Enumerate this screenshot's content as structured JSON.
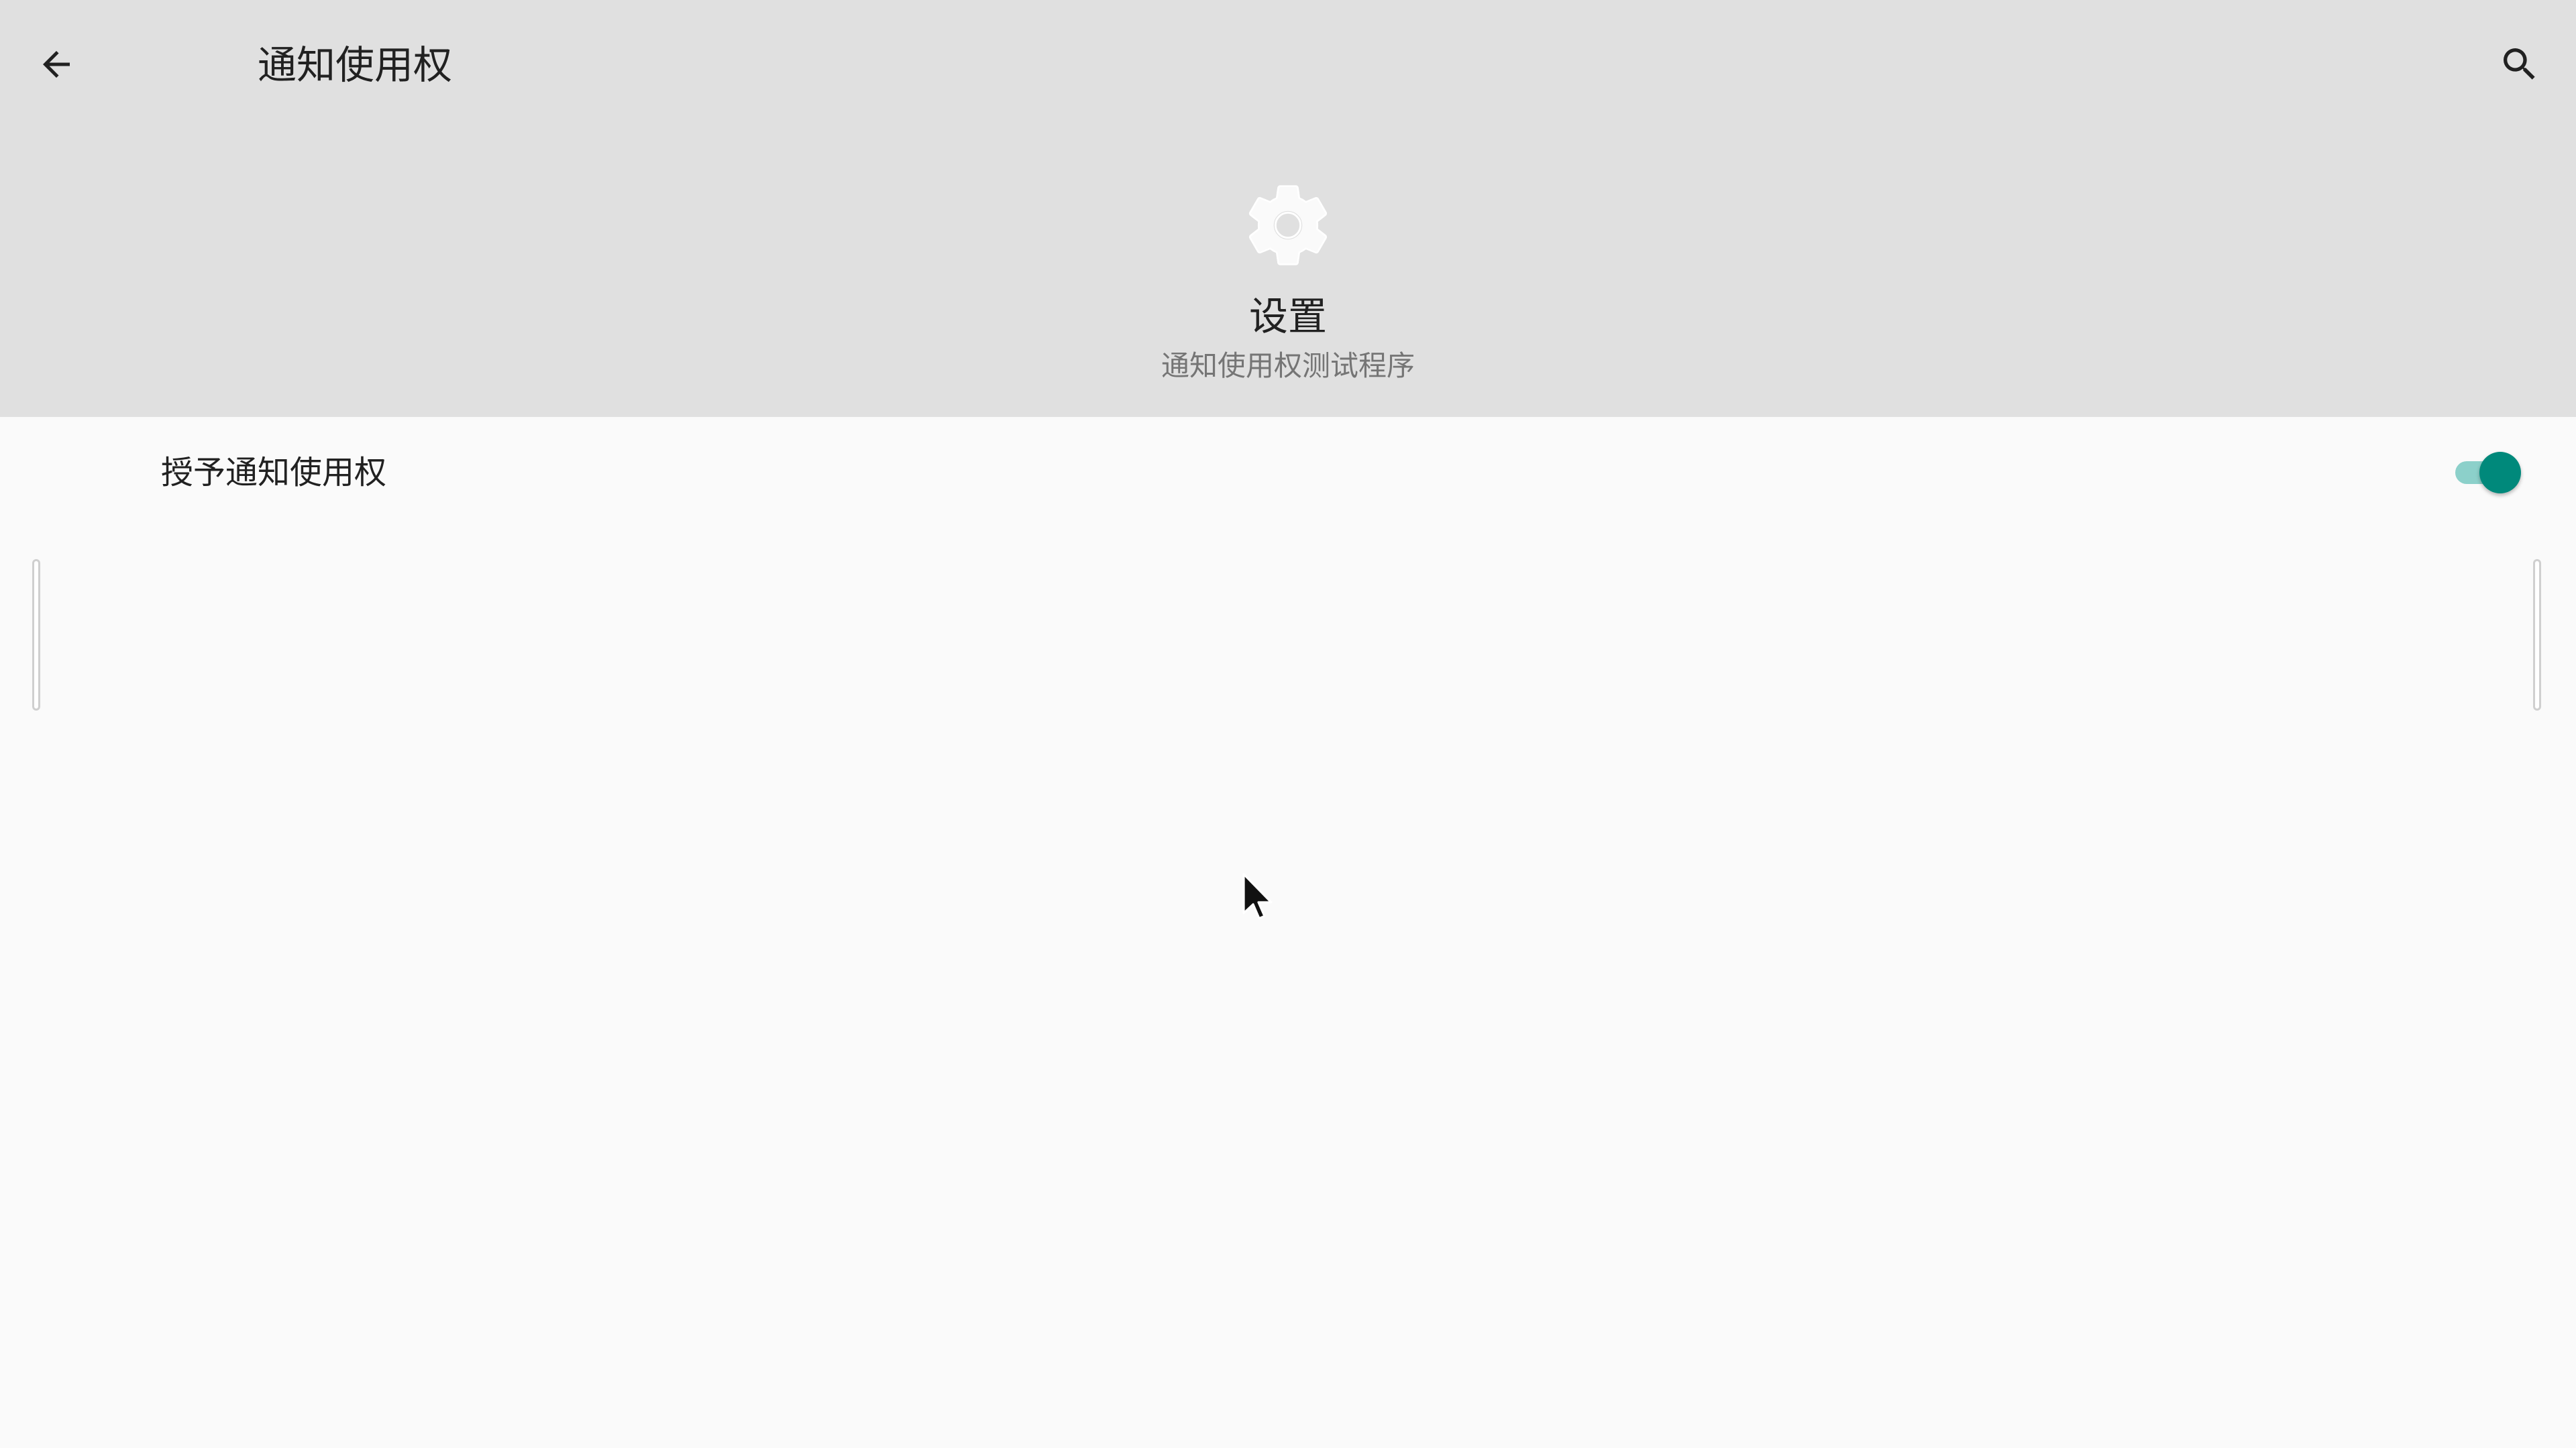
{
  "header": {
    "title": "通知使用权",
    "back_icon": "arrow-back-icon",
    "search_icon": "search-icon"
  },
  "app": {
    "icon": "gear-icon",
    "name": "设置",
    "summary": "通知使用权测试程序"
  },
  "settings": {
    "grant_access_label": "授予通知使用权",
    "grant_access_enabled": true
  },
  "colors": {
    "header_bg": "#e0e0e0",
    "body_bg": "#fafafa",
    "accent": "#00897b",
    "accent_track": "#80cbc4"
  }
}
